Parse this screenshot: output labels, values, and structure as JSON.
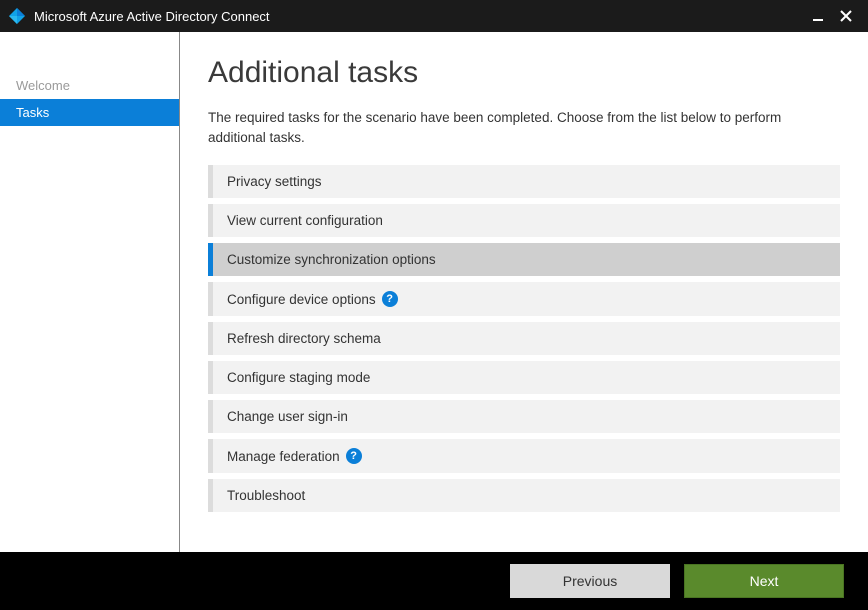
{
  "window": {
    "title": "Microsoft Azure Active Directory Connect"
  },
  "sidebar": {
    "items": [
      {
        "label": "Welcome",
        "active": false
      },
      {
        "label": "Tasks",
        "active": true
      }
    ]
  },
  "main": {
    "heading": "Additional tasks",
    "description": "The required tasks for the scenario have been completed. Choose from the list below to perform additional tasks.",
    "tasks": [
      {
        "label": "Privacy settings",
        "selected": false,
        "help": false
      },
      {
        "label": "View current configuration",
        "selected": false,
        "help": false
      },
      {
        "label": "Customize synchronization options",
        "selected": true,
        "help": false
      },
      {
        "label": "Configure device options",
        "selected": false,
        "help": true
      },
      {
        "label": "Refresh directory schema",
        "selected": false,
        "help": false
      },
      {
        "label": "Configure staging mode",
        "selected": false,
        "help": false
      },
      {
        "label": "Change user sign-in",
        "selected": false,
        "help": false
      },
      {
        "label": "Manage federation",
        "selected": false,
        "help": true
      },
      {
        "label": "Troubleshoot",
        "selected": false,
        "help": false
      }
    ]
  },
  "footer": {
    "previous": "Previous",
    "next": "Next"
  }
}
